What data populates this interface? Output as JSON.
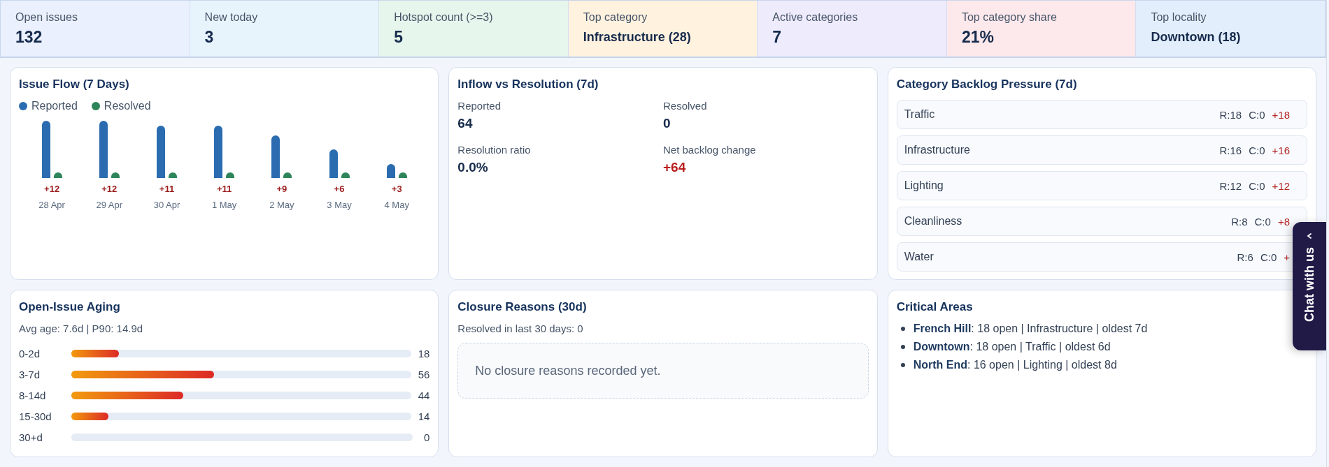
{
  "kpis": [
    {
      "label": "Open issues",
      "value": "132",
      "color": "#eaf0fd"
    },
    {
      "label": "New today",
      "value": "3",
      "color": "#e7f4fc"
    },
    {
      "label": "Hotspot count (>=3)",
      "value": "5",
      "color": "#e6f6ec"
    },
    {
      "label": "Top category",
      "value": "Infrastructure (28)",
      "color": "#fff2df",
      "kind": "text"
    },
    {
      "label": "Active categories",
      "value": "7",
      "color": "#eeebfd"
    },
    {
      "label": "Top category share",
      "value": "21%",
      "color": "#fde8eb"
    },
    {
      "label": "Top locality",
      "value": "Downtown (18)",
      "color": "#e2eefb",
      "kind": "text"
    }
  ],
  "issue_flow": {
    "title": "Issue Flow (7 Days)",
    "legend": [
      {
        "label": "Reported",
        "color": "#2b6cb0"
      },
      {
        "label": "Resolved",
        "color": "#2f855a"
      }
    ],
    "days": [
      {
        "date": "28 Apr",
        "net": "+12"
      },
      {
        "date": "29 Apr",
        "net": "+12"
      },
      {
        "date": "30 Apr",
        "net": "+11"
      },
      {
        "date": "1 May",
        "net": "+11"
      },
      {
        "date": "2 May",
        "net": "+9"
      },
      {
        "date": "3 May",
        "net": "+6"
      },
      {
        "date": "4 May",
        "net": "+3"
      }
    ]
  },
  "inflow": {
    "title": "Inflow vs Resolution (7d)",
    "stats": [
      {
        "label": "Reported",
        "value": "64",
        "kind": "plain"
      },
      {
        "label": "Resolved",
        "value": "0",
        "kind": "plain"
      },
      {
        "label": "Resolution ratio",
        "value": "0.0%",
        "kind": "plain"
      },
      {
        "label": "Net backlog change",
        "value": "+64",
        "kind": "alert"
      }
    ]
  },
  "backlog": {
    "title": "Category Backlog Pressure (7d)",
    "rows": [
      {
        "name": "Traffic",
        "reported": "R:18",
        "closed": "C:0",
        "delta": "+18"
      },
      {
        "name": "Infrastructure",
        "reported": "R:16",
        "closed": "C:0",
        "delta": "+16"
      },
      {
        "name": "Lighting",
        "reported": "R:12",
        "closed": "C:0",
        "delta": "+12"
      },
      {
        "name": "Cleanliness",
        "reported": "R:8",
        "closed": "C:0",
        "delta": "+8"
      },
      {
        "name": "Water",
        "reported": "R:6",
        "closed": "C:0",
        "delta": "+"
      }
    ]
  },
  "aging": {
    "title": "Open-Issue Aging",
    "summary": "Avg age: 7.6d | P90: 14.9d",
    "buckets": [
      {
        "label": "0-2d",
        "level": 0.14,
        "count": "18"
      },
      {
        "label": "3-7d",
        "level": 0.42,
        "count": "56"
      },
      {
        "label": "8-14d",
        "level": 0.33,
        "count": "44"
      },
      {
        "label": "15-30d",
        "level": 0.11,
        "count": "14"
      },
      {
        "label": "30+d",
        "count": "0"
      }
    ]
  },
  "closure": {
    "title": "Closure Reasons (30d)",
    "summary": "Resolved in last 30 days: 0",
    "empty_message": "No closure reasons recorded yet."
  },
  "critical": {
    "title": "Critical Areas",
    "items": [
      "**French Hill**: 18 open | Infrastructure | oldest 7d",
      "**Downtown**: 18 open | Traffic | oldest 6d",
      "**North End**: 16 open | Lighting | oldest 8d"
    ]
  },
  "chat": {
    "label": "Chat with us"
  }
}
